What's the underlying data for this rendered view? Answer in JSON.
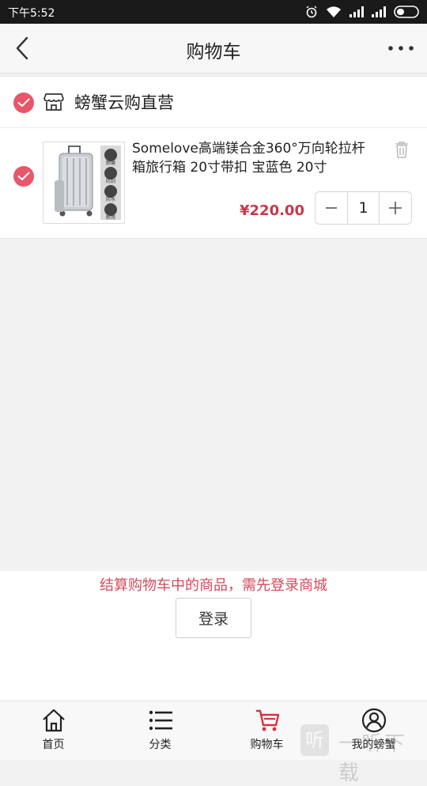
{
  "status_bar": {
    "time": "下午5:52"
  },
  "header": {
    "title": "购物车"
  },
  "store": {
    "name": "螃蟹云购直营"
  },
  "item": {
    "title": "Somelove高端镁合金360°万向轮拉杆箱旅行箱 20寸带扣 宝蓝色 20寸",
    "price": "¥220.00",
    "quantity": "1",
    "thumb_tags": [
      "耐磨",
      "防刮",
      "防水",
      "耐用"
    ]
  },
  "login_prompt": {
    "message": "结算购物车中的商品，需先登录商城",
    "button_label": "登录"
  },
  "tabbar": {
    "tabs": [
      {
        "label": "首页",
        "icon": "home-icon"
      },
      {
        "label": "分类",
        "icon": "list-icon"
      },
      {
        "label": "购物车",
        "icon": "cart-icon"
      },
      {
        "label": "我的螃蟹",
        "icon": "user-icon"
      }
    ]
  },
  "watermark": {
    "glyph": "听",
    "text": "一听下载"
  },
  "colors": {
    "accent": "#e8566a",
    "price": "#c7384a",
    "cart_tab": "#d8313f"
  }
}
